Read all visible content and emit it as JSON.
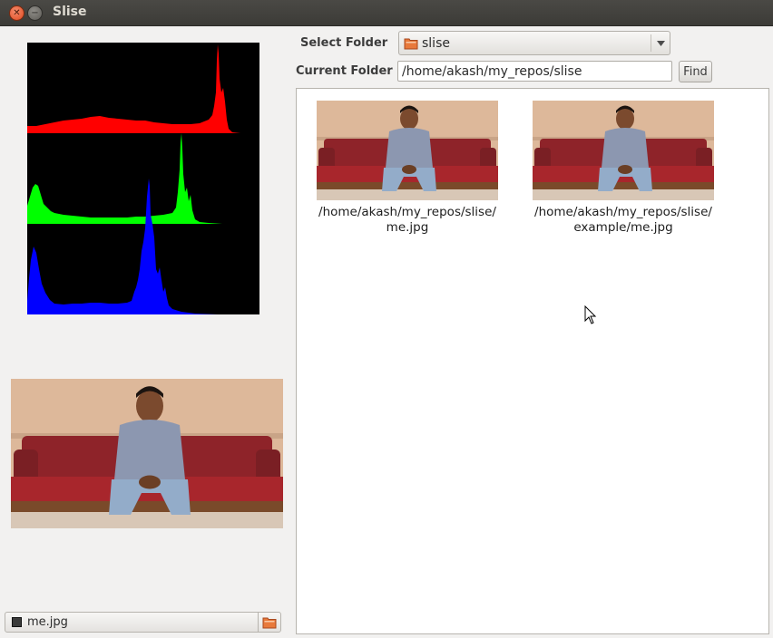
{
  "window": {
    "title": "Slise"
  },
  "form": {
    "select_folder_label": "Select Folder",
    "selected_folder": "slise",
    "current_folder_label": "Current Folder",
    "current_folder_value": "/home/akash/my_repos/slise",
    "find_label": "Find"
  },
  "results": [
    {
      "caption_line1": "/home/akash/my_repos/slise/",
      "caption_line2": "me.jpg"
    },
    {
      "caption_line1": "/home/akash/my_repos/slise/",
      "caption_line2": "example/me.jpg"
    }
  ],
  "file_chooser": {
    "filename": "me.jpg"
  },
  "histogram": {
    "channels": [
      "red",
      "green",
      "blue"
    ],
    "colors": {
      "red": "#ff0000",
      "green": "#00ff00",
      "blue": "#0000ff",
      "background": "#000000"
    }
  },
  "icons": {
    "close": "close-icon",
    "minimize": "minimize-icon",
    "folder": "folder-icon",
    "dropdown": "chevron-down-icon",
    "file": "file-icon",
    "open": "open-folder-icon",
    "cursor": "mouse-pointer-icon"
  }
}
